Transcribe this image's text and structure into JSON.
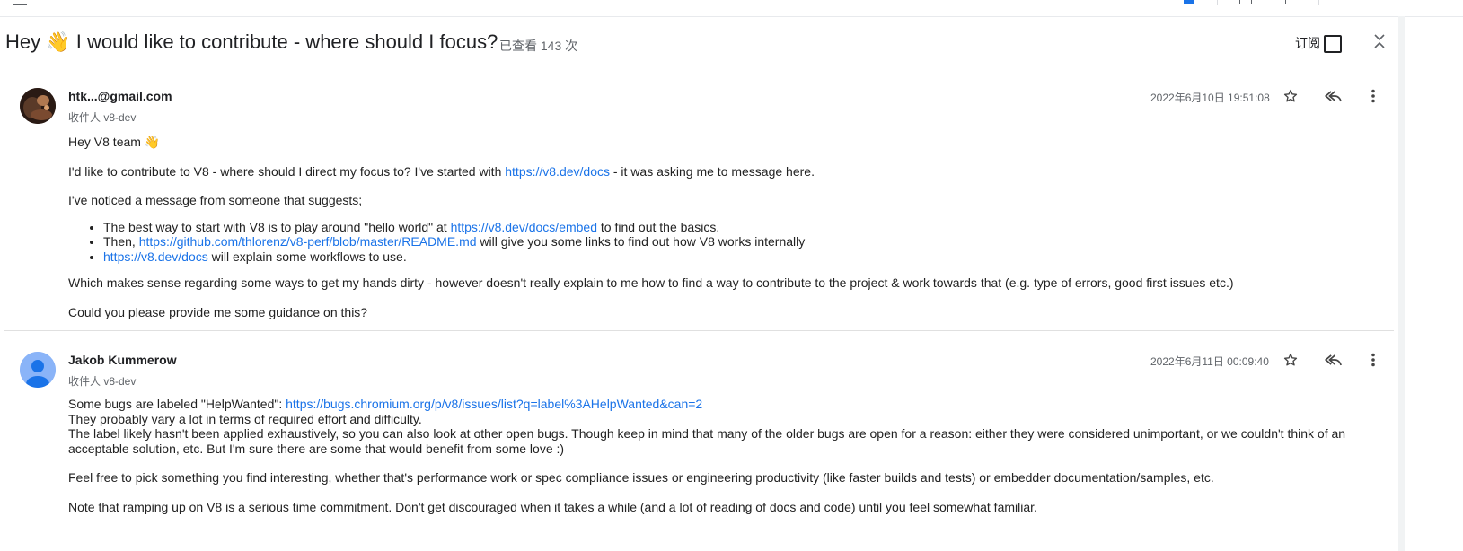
{
  "thread": {
    "subject": "Hey 👋 I would like to contribute - where should I focus?",
    "views": "已查看 143 次",
    "subscribe_label": "订阅"
  },
  "messages": [
    {
      "sender": "htk...@gmail.com",
      "to": "收件人 v8-dev",
      "date": "2022年6月10日 19:51:08",
      "greeting": "Hey V8 team 👋",
      "p1_text": "I'd like to contribute to V8 - where should I direct my focus to? I've started with ",
      "p1_link": "https://v8.dev/docs",
      "p1_tail": " - it was asking me to message here.",
      "p2": "I've noticed a message from someone that suggests;",
      "bullets": [
        {
          "pre": "The best way to start with V8 is to play around \"hello world\" at ",
          "link": "https://v8.dev/docs/embed",
          "post": " to find out the basics."
        },
        {
          "pre": "Then, ",
          "link": "https://github.com/thlorenz/v8-perf/blob/master/README.md",
          "post": " will give you some links to find out how V8 works internally"
        },
        {
          "pre": "",
          "link": "https://v8.dev/docs",
          "post": " will explain some workflows to use."
        }
      ],
      "p3": "Which makes sense regarding some ways to get my hands dirty - however doesn't really explain to me how to find a way to contribute to the project & work towards that (e.g. type of errors, good first issues etc.)",
      "p4": "Could you please provide me some guidance on this?"
    },
    {
      "sender": "Jakob Kummerow",
      "to": "收件人 v8-dev",
      "date": "2022年6月11日 00:09:40",
      "line1_text": "Some bugs are labeled \"HelpWanted\": ",
      "line1_link": "https://bugs.chromium.org/p/v8/issues/list?q=label%3AHelpWanted&can=2",
      "line2": "They probably vary a lot in terms of required effort and difficulty.",
      "line3": "The label likely hasn't been applied exhaustively, so you can also look at other open bugs. Though keep in mind that many of the older bugs are open for a reason: either they were considered unimportant, or we couldn't think of an acceptable solution, etc. But I'm sure there are some that would benefit from some love :)",
      "p2": "Feel free to pick something you find interesting, whether that's performance work or spec compliance issues or engineering productivity (like faster builds and tests) or embedder documentation/samples, etc.",
      "p3": "Note that ramping up on V8 is a serious time commitment. Don't get discouraged when it takes a while (and a lot of reading of docs and code) until you feel somewhat familiar."
    }
  ],
  "icons": {
    "star": "star-icon",
    "reply_all": "reply-all-icon",
    "more": "more-vert-icon",
    "collapse": "collapse-all-icon",
    "checkbox": "subscribe-checkbox"
  },
  "colors": {
    "link": "#1a73e8",
    "avatar_default": "#8ab4f8",
    "avatar_person": "#1a73e8"
  }
}
